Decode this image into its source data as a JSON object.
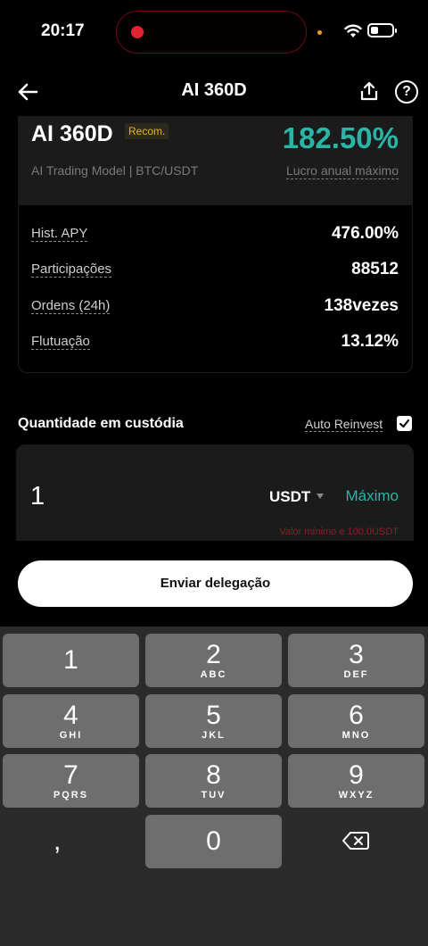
{
  "status_bar": {
    "time": "20:17"
  },
  "nav": {
    "title": "AI 360D"
  },
  "product": {
    "name": "AI 360D",
    "badge": "Recom.",
    "apy": "182.50%",
    "subtitle": "AI Trading Model | BTC/USDT",
    "apy_label": "Lucro anual máximo"
  },
  "stats": [
    {
      "label": "Hist. APY",
      "value": "476.00%"
    },
    {
      "label": "Participações",
      "value": "88512"
    },
    {
      "label": "Ordens (24h)",
      "value": "138vezes"
    },
    {
      "label": "Flutuação",
      "value": "13.12%"
    }
  ],
  "custody": {
    "title": "Quantidade em custódia",
    "auto_reinvest_label": "Auto Reinvest",
    "auto_reinvest_checked": true,
    "amount": "1",
    "currency": "USDT",
    "max_label": "Máximo",
    "min_warning": "Valor mínimo é 100.0USDT"
  },
  "submit_label": "Enviar delegação",
  "keyboard": {
    "keys": [
      {
        "num": "1",
        "letters": ""
      },
      {
        "num": "2",
        "letters": "ABC"
      },
      {
        "num": "3",
        "letters": "DEF"
      },
      {
        "num": "4",
        "letters": "GHI"
      },
      {
        "num": "5",
        "letters": "JKL"
      },
      {
        "num": "6",
        "letters": "MNO"
      },
      {
        "num": "7",
        "letters": "PQRS"
      },
      {
        "num": "8",
        "letters": "TUV"
      },
      {
        "num": "9",
        "letters": "WXYZ"
      },
      {
        "num": "0",
        "letters": ""
      }
    ],
    "comma": ",",
    "delete_icon": "backspace-icon"
  },
  "colors": {
    "accent": "#29b6a6",
    "badge": "#e6b422",
    "warning": "#8b1e28"
  }
}
